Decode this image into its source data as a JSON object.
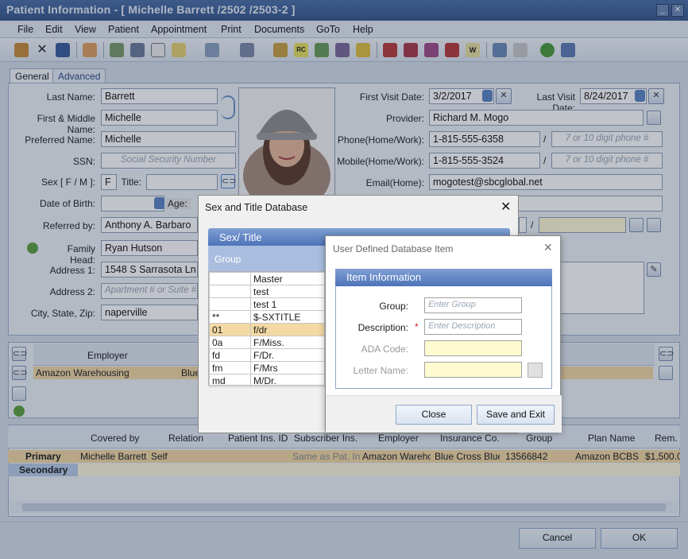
{
  "window": {
    "title": "Patient Information - [ Michelle Barrett /2502 /2503-2 ]"
  },
  "menu": [
    "File",
    "Edit",
    "View",
    "Patient",
    "Appointment",
    "Print",
    "Documents",
    "GoTo",
    "Help"
  ],
  "tabs": [
    "General",
    "Advanced"
  ],
  "form": {
    "last_name_label": "Last Name:",
    "last_name": "Barrett",
    "first_name_label": "First & Middle Name:",
    "first_name": "Michelle",
    "preferred_label": "Preferred Name:",
    "preferred": "Michelle",
    "ssn_label": "SSN:",
    "ssn_ph": "Social Security Number",
    "sex_label": "Sex [ F / M ]:",
    "sex": "F",
    "title_label": "Title:",
    "dob_label": "Date of Birth:",
    "age_label": "Age:",
    "referred_label": "Referred by:",
    "referred": "Anthony A. Barbaro",
    "family_label": "Family Head:",
    "family": "Ryan Hutson",
    "addr1_label": "Address 1:",
    "addr1": "1548 S Sarrasota Ln",
    "addr2_label": "Address 2:",
    "addr2_ph": "Apartment # or Suite #",
    "city_label": "City, State, Zip:",
    "city": "naperville",
    "first_visit_label": "First Visit Date:",
    "first_visit": "3/2/2017",
    "last_visit_label": "Last Visit Date:",
    "last_visit": "8/24/2017",
    "provider_label": "Provider:",
    "provider": "Richard M. Mogo",
    "phone_label": "Phone(Home/Work):",
    "phone": "1-815-555-6358",
    "phone_ph": "7 or 10 digit phone #",
    "mobile_label": "Mobile(Home/Work):",
    "mobile": "1-815-555-3524",
    "mobile_ph": "7 or 10 digit phone #",
    "email_label": "Email(Home):",
    "email": "mogotest@sbcglobal.net",
    "slash": "/"
  },
  "employer": {
    "header": "Employer",
    "row": "Amazon Warehousing",
    "row2": "Blue"
  },
  "insurance": {
    "headers": [
      "Covered by",
      "Relation",
      "Patient Ins. ID",
      "Subscriber Ins. I",
      "Employer",
      "Insurance Co.",
      "Group",
      "Plan Name",
      "Rem. B"
    ],
    "primary_label": "Primary",
    "secondary_label": "Secondary",
    "primary": [
      "Michelle Barrett",
      "Self",
      "",
      "Same as Pat. In",
      "Amazon Wareho",
      "Blue Cross Blue",
      "13566842",
      "Amazon BCBS",
      "$1,500.0"
    ]
  },
  "footer": {
    "cancel": "Cancel",
    "ok": "OK"
  },
  "sex_dialog": {
    "title": "Sex and Title Database",
    "panel_title": "Sex/ Title",
    "group_header": "Group",
    "rows": [
      [
        "",
        "Master"
      ],
      [
        "",
        "test"
      ],
      [
        "",
        "test 1"
      ],
      [
        "**",
        "$-SXTITLE"
      ],
      [
        "01",
        "f/dr"
      ],
      [
        "0a",
        "F/Miss."
      ],
      [
        "fd",
        "F/Dr."
      ],
      [
        "fm",
        "F/Mrs"
      ],
      [
        "md",
        "M/Dr."
      ]
    ]
  },
  "item_dialog": {
    "title": "User Defined Database Item",
    "section": "Item Information",
    "group_label": "Group:",
    "group_ph": "Enter Group",
    "desc_label": "Description:",
    "desc_ph": "Enter Description",
    "required": "*",
    "ada_label": "ADA Code:",
    "letter_label": "Letter Name:",
    "close": "Close",
    "save": "Save and Exit"
  },
  "colors": {
    "accent": "#4a6ea8",
    "highlight": "#f3d9a4",
    "required": "#cc2222"
  }
}
